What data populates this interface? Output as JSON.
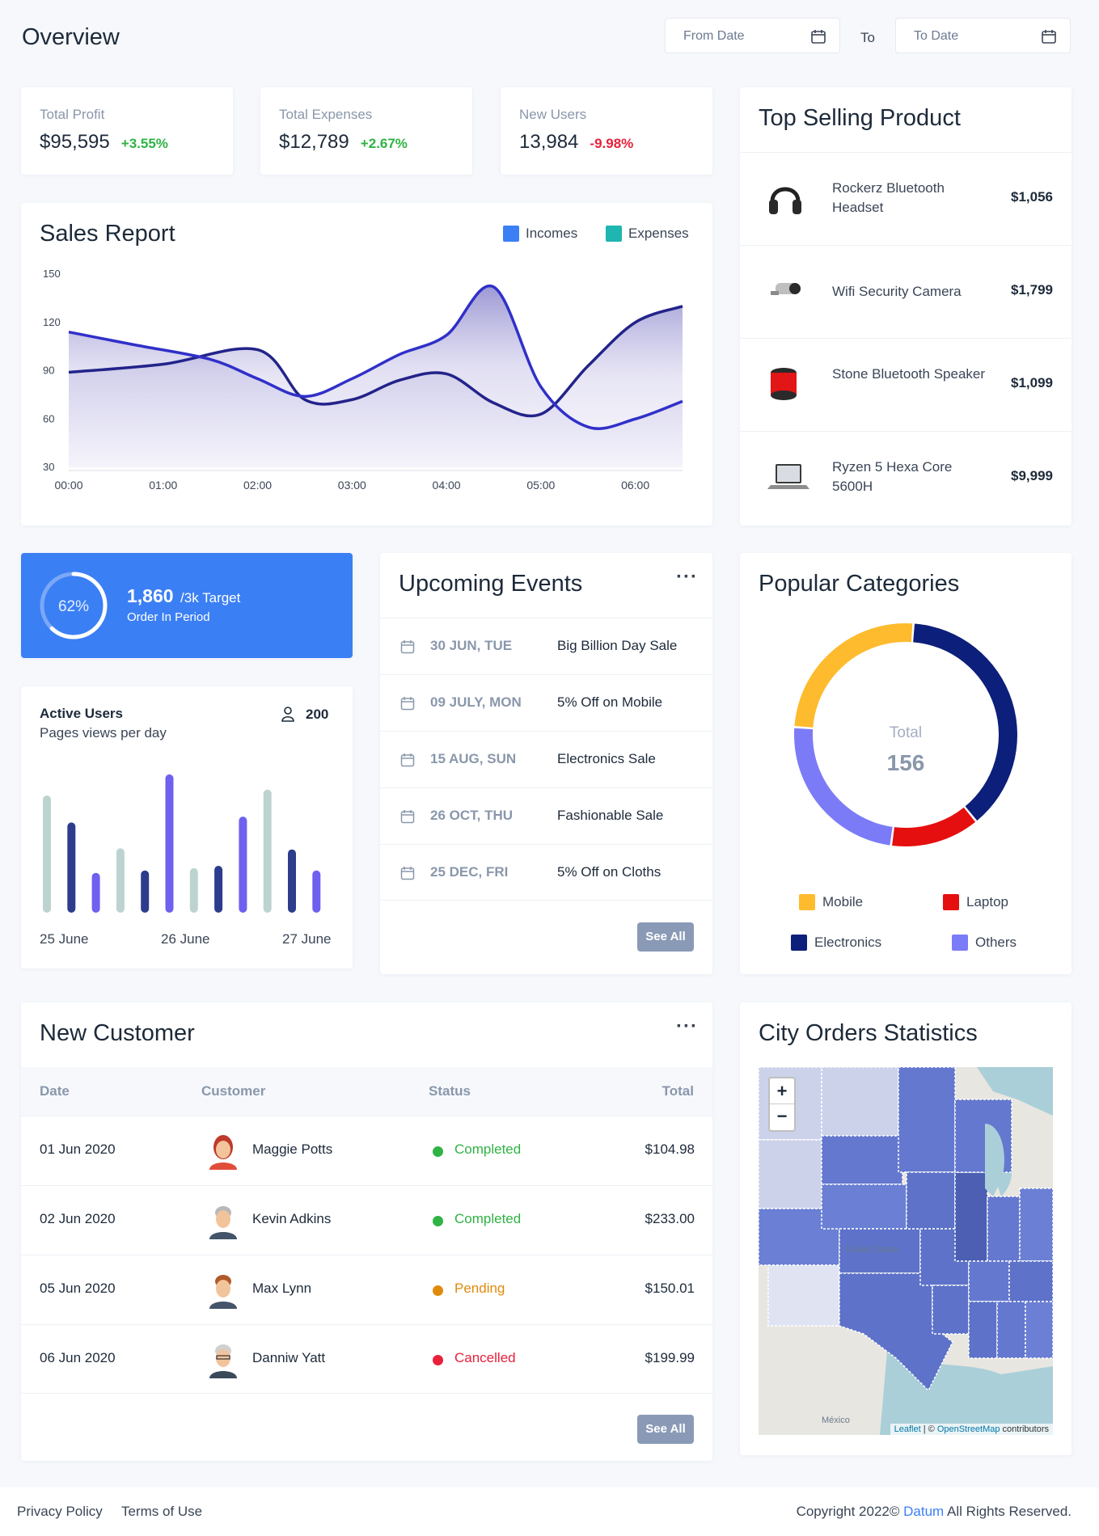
{
  "header": {
    "title": "Overview",
    "from_placeholder": "From Date",
    "to_label": "To",
    "to_placeholder": "To Date"
  },
  "stats": [
    {
      "label": "Total Profit",
      "value": "$95,595",
      "change": "+3.55%",
      "trend": "up"
    },
    {
      "label": "Total Expenses",
      "value": "$12,789",
      "change": "+2.67%",
      "trend": "up"
    },
    {
      "label": "New Users",
      "value": "13,984",
      "change": "-9.98%",
      "trend": "down"
    }
  ],
  "sales_report": {
    "title": "Sales Report",
    "legend": [
      {
        "name": "Incomes",
        "color": "#3b7ff5"
      },
      {
        "name": "Expenses",
        "color": "#1fb5b0"
      }
    ],
    "chart_data": {
      "type": "area",
      "categories": [
        "00:00",
        "01:00",
        "02:00",
        "03:00",
        "04:00",
        "05:00",
        "06:00"
      ],
      "yticks": [
        150,
        120,
        90,
        60,
        30
      ],
      "ylim": [
        30,
        150
      ],
      "series": [
        {
          "name": "Incomes",
          "color": "#23238a",
          "x": [
            0,
            1,
            2,
            2.5,
            3,
            3.5,
            4,
            4.5,
            5,
            5.5,
            6,
            6.5
          ],
          "values": [
            89,
            94,
            103,
            72,
            72,
            84,
            88,
            70,
            63,
            93,
            120,
            130
          ]
        },
        {
          "name": "Expenses",
          "color": "#3030c9",
          "x": [
            0,
            0.7,
            1.5,
            2,
            2.5,
            3,
            3.5,
            4,
            4.5,
            5,
            5.5,
            6,
            6.5
          ],
          "values": [
            114,
            106,
            97,
            85,
            74,
            85,
            100,
            112,
            142,
            80,
            55,
            60,
            71
          ]
        }
      ]
    }
  },
  "top_selling": {
    "title": "Top Selling Product",
    "products": [
      {
        "name": "Rockerz Bluetooth Headset",
        "price": "$1,056",
        "icon": "headset-icon"
      },
      {
        "name": "Wifi Security Camera",
        "price": "$1,799",
        "icon": "camera-icon"
      },
      {
        "name": "Stone Bluetooth Speaker",
        "price": "$1,099",
        "icon": "speaker-icon"
      },
      {
        "name": "Ryzen 5 Hexa Core 5600H",
        "price": "$9,999",
        "icon": "laptop-icon"
      }
    ]
  },
  "target_card": {
    "percent_label": "62%",
    "percent": 0.62,
    "value": "1,860",
    "target": "/3k Target",
    "subtitle": "Order In Period"
  },
  "active_users": {
    "title": "Active Users",
    "subtitle": "Pages views per day",
    "count": "200",
    "chart_data": {
      "type": "bar",
      "categories": [
        "25 June",
        "26 June",
        "27 June"
      ],
      "values": [
        100,
        85,
        28,
        60,
        30,
        100,
        32,
        34,
        68,
        85,
        46,
        30
      ],
      "colors": [
        "#bdd3d0",
        "#2d3c8c",
        "#6f60f0",
        "#bdd3d0",
        "#2d3c8c",
        "#6f60f0",
        "#bdd3d0",
        "#2d3c8c",
        "#6f60f0",
        "#bdd3d0",
        "#2d3c8c",
        "#6f60f0"
      ],
      "ylim": [
        0,
        100
      ],
      "heights_rel": [
        1.0,
        0.77,
        0.34,
        0.55,
        0.36,
        1.18,
        0.38,
        0.4,
        0.82,
        1.05,
        0.54,
        0.36
      ]
    }
  },
  "events": {
    "title": "Upcoming Events",
    "items": [
      {
        "date": "30 JUN, TUE",
        "name": "Big Billion Day Sale"
      },
      {
        "date": "09 JULY, MON",
        "name": "5% Off on Mobile"
      },
      {
        "date": "15 AUG, SUN",
        "name": "Electronics Sale"
      },
      {
        "date": "26 OCT, THU",
        "name": "Fashionable Sale"
      },
      {
        "date": "25 DEC, FRI",
        "name": "5% Off on Cloths"
      }
    ],
    "see_all": "See All"
  },
  "categories": {
    "title": "Popular Categories",
    "total_label": "Total",
    "total_value": "156",
    "chart_data": {
      "type": "pie",
      "slices": [
        {
          "name": "Mobile",
          "value": 25,
          "color": "#fdbb2d"
        },
        {
          "name": "Electronics",
          "value": 38,
          "color": "#0c1f7a"
        },
        {
          "name": "Laptop",
          "value": 13,
          "color": "#e60f0f"
        },
        {
          "name": "Others",
          "value": 24,
          "color": "#7c7bf7"
        }
      ]
    },
    "legend": [
      "Mobile",
      "Laptop",
      "Electronics",
      "Others"
    ]
  },
  "customers": {
    "title": "New Customer",
    "columns": [
      "Date",
      "Customer",
      "Status",
      "Total"
    ],
    "rows": [
      {
        "date": "01 Jun 2020",
        "name": "Maggie Potts",
        "status": "Completed",
        "total": "$104.98",
        "status_color": "#2fb344"
      },
      {
        "date": "02 Jun 2020",
        "name": "Kevin Adkins",
        "status": "Completed",
        "total": "$233.00",
        "status_color": "#2fb344"
      },
      {
        "date": "05 Jun 2020",
        "name": "Max Lynn",
        "status": "Pending",
        "total": "$150.01",
        "status_color": "#e08a0b"
      },
      {
        "date": "06 Jun 2020",
        "name": "Danniw Yatt",
        "status": "Cancelled",
        "total": "$199.99",
        "status_color": "#e8203a"
      }
    ],
    "see_all": "See All"
  },
  "city_orders": {
    "title": "City Orders Statistics",
    "zoom_in": "+",
    "zoom_out": "−",
    "map_label": "United States",
    "map_label2": "México",
    "attribution_leaflet": "Leaflet",
    "attribution_sep": " | © ",
    "attribution_osm": "OpenStreetMap",
    "attribution_tail": " contributors"
  },
  "footer": {
    "privacy": "Privacy Policy",
    "terms": "Terms of Use",
    "copyright_pre": "Copyright 2022© ",
    "brand": "Datum",
    "copyright_post": " All Rights Reserved.",
    "brand_color": "#3b7ff5"
  }
}
